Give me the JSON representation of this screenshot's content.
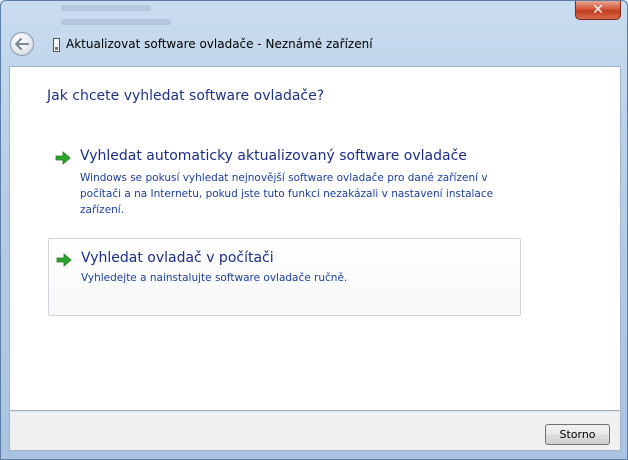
{
  "window": {
    "title": "Aktualizovat software ovladače - Neznámé zařízení",
    "close_glyph": "✕"
  },
  "main": {
    "question": "Jak chcete vyhledat software ovladače?",
    "options": [
      {
        "title": "Vyhledat automaticky aktualizovaný software ovladače",
        "description": "Windows se pokusí vyhledat nejnovější software ovladače pro dané zařízení v počítači a na Internetu, pokud jste tuto funkci nezakázali v nastavení instalace zařízení.",
        "icon": "green-arrow-icon"
      },
      {
        "title": "Vyhledat ovladač v počítači",
        "description": "Vyhledejte a nainstalujte software ovladače ručně.",
        "icon": "green-arrow-icon"
      }
    ]
  },
  "footer": {
    "cancel_label": "Storno"
  },
  "colors": {
    "heading": "#1e3287",
    "link": "#1b2d86",
    "arrow": "#2ca52c",
    "close": "#c23d1f"
  }
}
